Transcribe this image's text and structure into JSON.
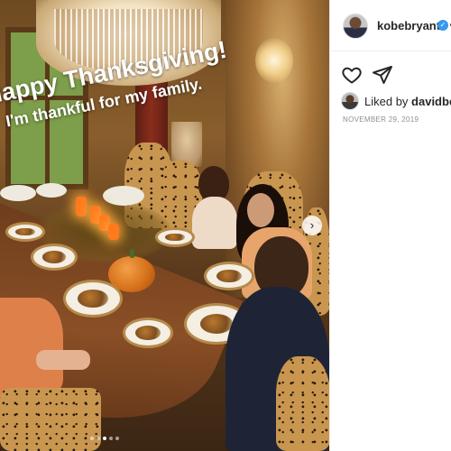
{
  "photo": {
    "caption_line1": "Happy Thanksgiving!",
    "caption_line2": "I'm thankful for my family.",
    "carousel_next_symbol": "›",
    "carousel": {
      "slides": 5,
      "active_index": 2
    }
  },
  "post": {
    "username": "kobebryant",
    "verified": true,
    "liked_by_prefix": "Liked by ",
    "liked_by_user": "davidbeck",
    "date": "NOVEMBER 29, 2019"
  },
  "icons": {
    "like": "heart-icon",
    "share": "send-icon",
    "verified": "verified-badge-icon",
    "next": "chevron-right-icon"
  },
  "colors": {
    "verified_blue": "#3897f0",
    "text_primary": "#262626",
    "text_secondary": "#8e8e8e"
  }
}
